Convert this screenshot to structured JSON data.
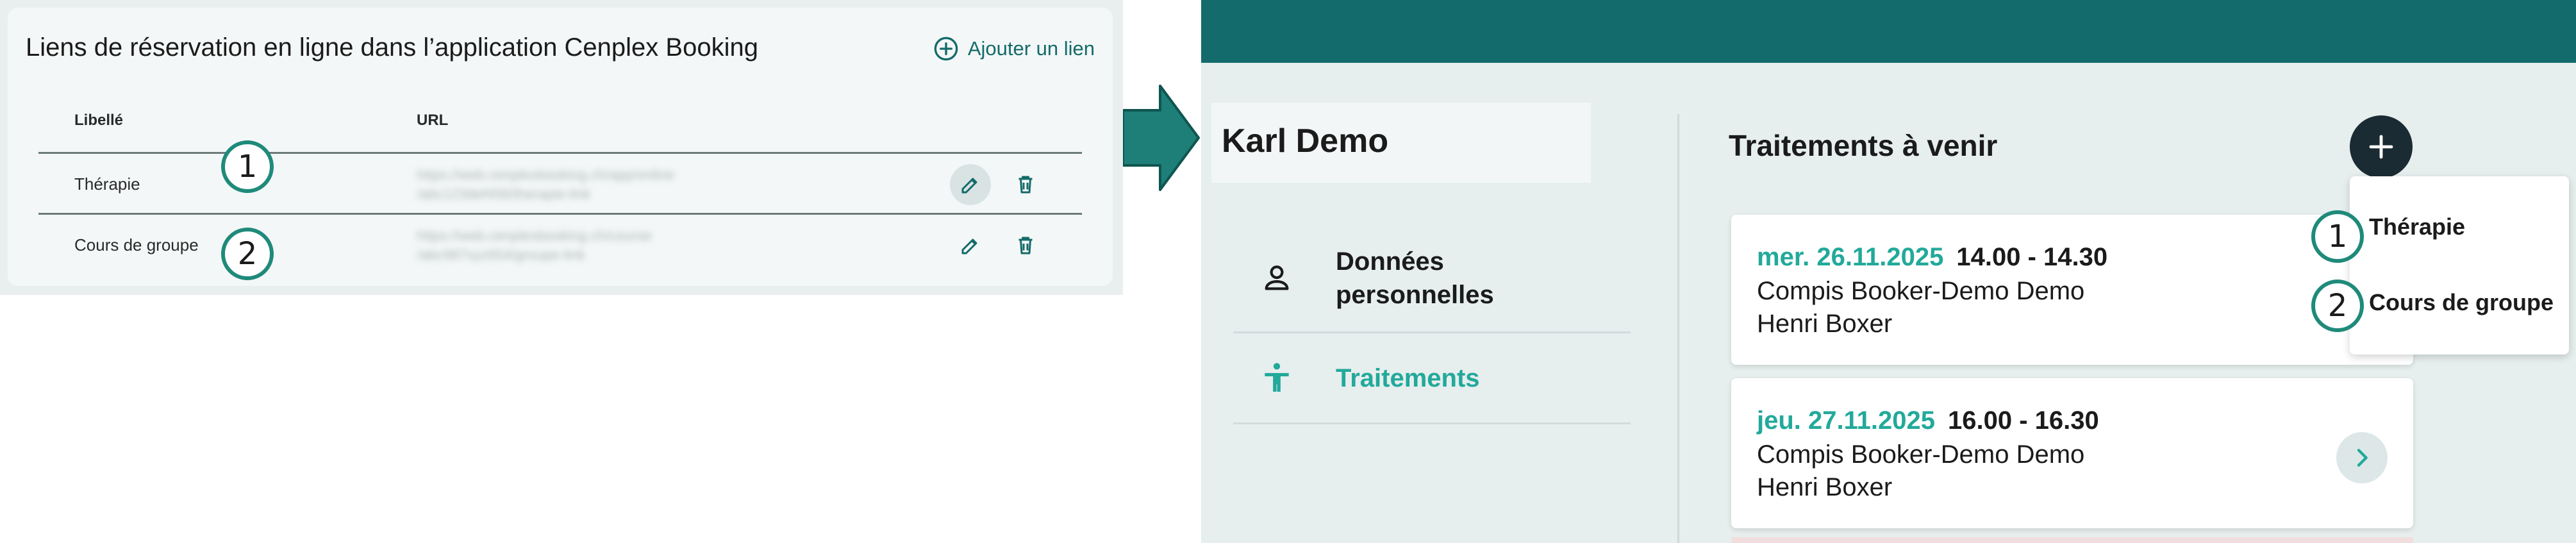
{
  "settings": {
    "title": "Liens de réservation en ligne dans l’application Cenplex Booking",
    "add_link_label": "Ajouter un lien",
    "columns": [
      "Libellé",
      "URL"
    ],
    "rows": [
      {
        "label": "Thérapie",
        "url_line1": "https://web.cenplexbooking.ch/app/online",
        "url_line2": "/abc123def456/therapie-link"
      },
      {
        "label": "Cours de groupe",
        "url_line1": "https://web.cenplexbooking.ch/course",
        "url_line2": "/abc987xyz654/groupe-link"
      }
    ]
  },
  "badges": [
    "1",
    "2"
  ],
  "app": {
    "patient_name": "Karl Demo",
    "nav": [
      {
        "label": "Données personnelles",
        "icon": "person-icon"
      },
      {
        "label": "Traitements",
        "icon": "accessibility-icon"
      }
    ],
    "section_title": "Traitements à venir",
    "appointments": [
      {
        "date": "mer. 26.11.2025",
        "time": "14.00 - 14.30",
        "service": "Compis Booker-Demo Demo",
        "therapist": "Henri Boxer"
      },
      {
        "date": "jeu. 27.11.2025",
        "time": "16.00 - 16.30",
        "service": "Compis Booker-Demo Demo",
        "therapist": "Henri Boxer"
      }
    ],
    "dropdown": [
      "Thérapie",
      "Cours de groupe"
    ]
  },
  "colors": {
    "teal_dark": "#146b6b",
    "teal_accent": "#22a99a",
    "badge_border": "#1f8a7a",
    "fab_bg": "#1b2b33"
  }
}
